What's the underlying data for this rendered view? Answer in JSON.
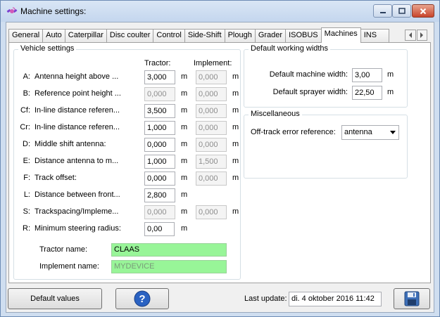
{
  "window": {
    "title": "Machine settings:"
  },
  "tabs": [
    "General",
    "Auto",
    "Caterpillar",
    "Disc coulter",
    "Control",
    "Side-Shift",
    "Plough",
    "Grader",
    "ISOBUS",
    "Machines",
    "INS"
  ],
  "active_tab": "Machines",
  "vehicle": {
    "group_title": "Vehicle settings",
    "col_tractor": "Tractor:",
    "col_implement": "Implement:",
    "rows": [
      {
        "letter": "A:",
        "label": "Antenna height above ...",
        "tractor": "3,000",
        "unit1": "m",
        "implement": "0,000",
        "unit2": "m"
      },
      {
        "letter": "B:",
        "label": "Reference point height ...",
        "tractor": "0,000",
        "unit1": "m",
        "implement": "0,000",
        "unit2": "m"
      },
      {
        "letter": "Cf:",
        "label": "In-line distance referen...",
        "tractor": "3,500",
        "unit1": "m",
        "implement": "0,000",
        "unit2": "m"
      },
      {
        "letter": "Cr:",
        "label": "In-line distance referen...",
        "tractor": "1,000",
        "unit1": "m",
        "implement": "0,000",
        "unit2": "m"
      },
      {
        "letter": "D:",
        "label": "Middle shift antenna:",
        "tractor": "0,000",
        "unit1": "m",
        "implement": "0,000",
        "unit2": "m"
      },
      {
        "letter": "E:",
        "label": "Distance antenna to m...",
        "tractor": "1,000",
        "unit1": "m",
        "implement": "1,500",
        "unit2": "m"
      },
      {
        "letter": "F:",
        "label": "Track offset:",
        "tractor": "0,000",
        "unit1": "m",
        "implement": "0,000",
        "unit2": "m"
      },
      {
        "letter": "L:",
        "label": "Distance between front...",
        "tractor": "2,800",
        "unit1": "m"
      },
      {
        "letter": "S:",
        "label": "Trackspacing/Impleme...",
        "tractor": "0,000",
        "unit1": "m",
        "implement": "0,000",
        "unit2": "m"
      },
      {
        "letter": "R:",
        "label": "Minimum steering radius:",
        "tractor": "0,00",
        "unit1": "m"
      }
    ],
    "tractor_name_label": "Tractor name:",
    "tractor_name": "CLAAS",
    "implement_name_label": "Implement name:",
    "implement_name": "MYDEVICE"
  },
  "widths": {
    "group_title": "Default working widths",
    "machine_label": "Default machine width:",
    "machine_value": "3,00",
    "machine_unit": "m",
    "sprayer_label": "Default sprayer width:",
    "sprayer_value": "22,50",
    "sprayer_unit": "m"
  },
  "misc": {
    "group_title": "Miscellaneous",
    "offtrack_label": "Off-track error reference:",
    "offtrack_value": "antenna"
  },
  "footer": {
    "default_values": "Default values",
    "help_symbol": "?",
    "last_update_label": "Last update:",
    "last_update_value": "di. 4 oktober 2016 11:42"
  },
  "icons": {
    "app": "satellite-icon",
    "minimize": "minimize-icon",
    "maximize": "maximize-icon",
    "close": "close-icon",
    "help": "help-icon",
    "save": "floppy-disk-icon"
  },
  "colors": {
    "name_field": "#98f598",
    "help_button": "#2a62c2",
    "close_button": "#c8442a"
  }
}
